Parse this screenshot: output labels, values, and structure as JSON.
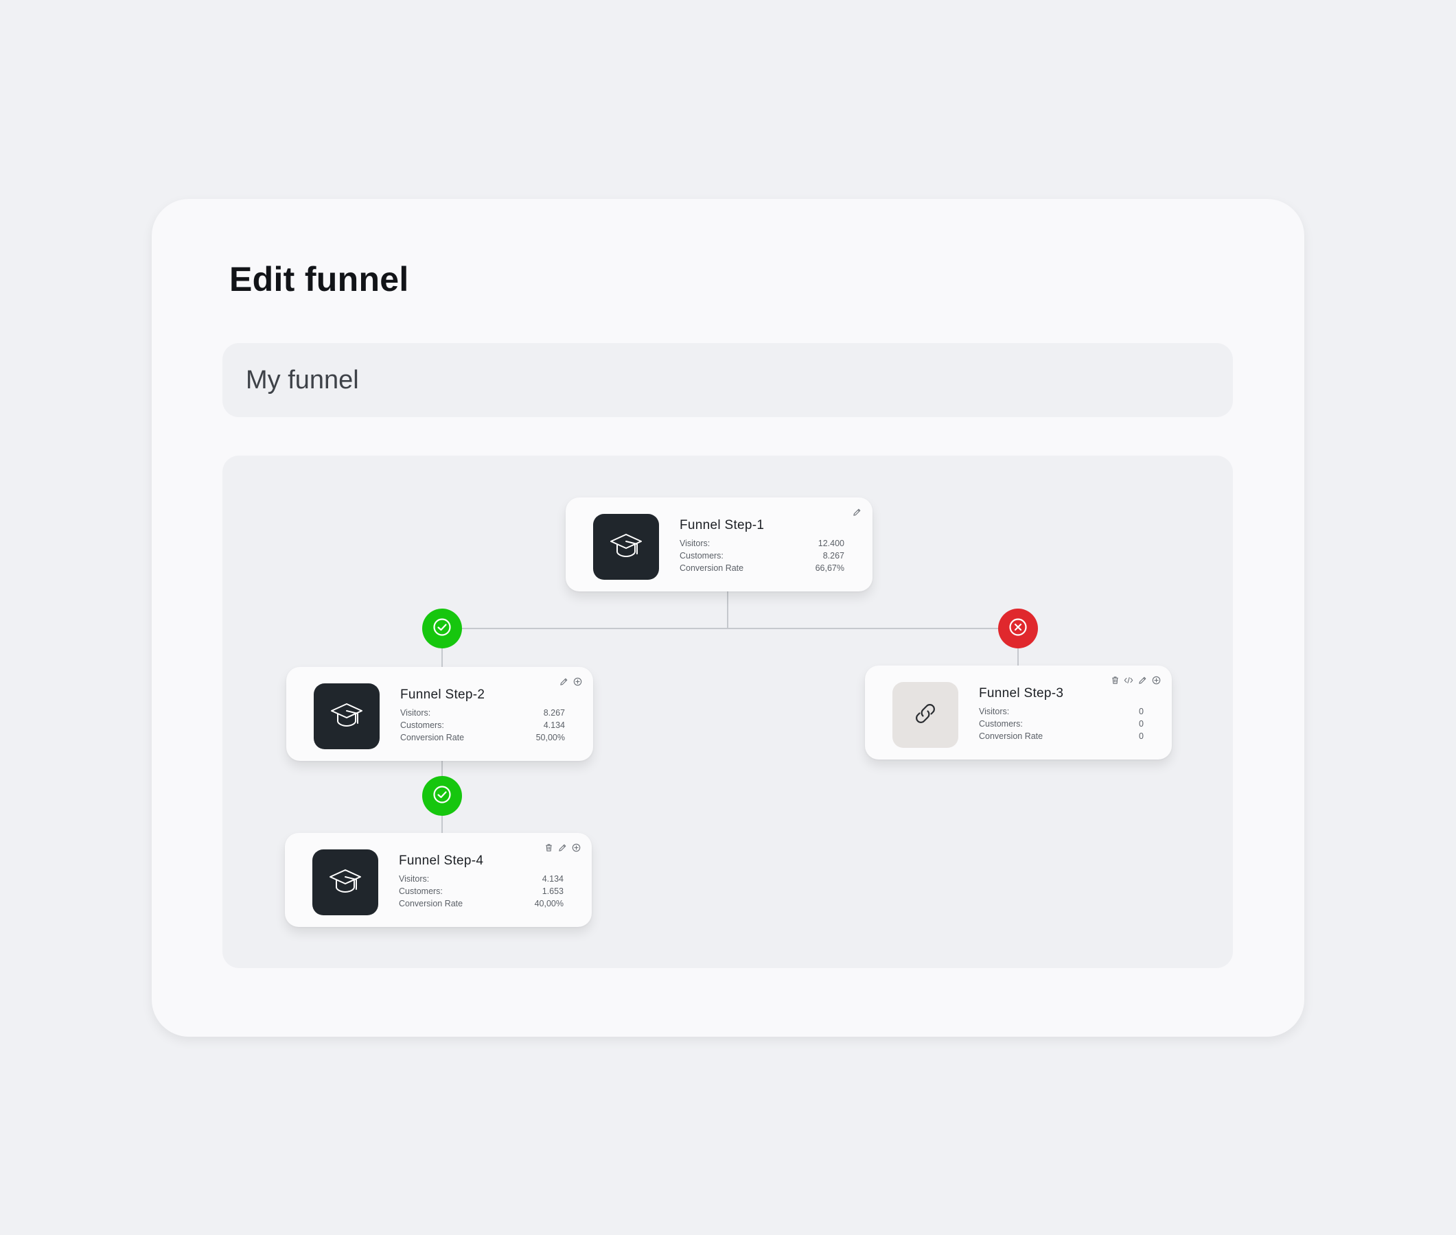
{
  "page": {
    "title": "Edit funnel"
  },
  "funnel_name": {
    "value": "My funnel"
  },
  "colors": {
    "success": "#16c60e",
    "failure": "#e0282d",
    "dark_thumb": "#20262c",
    "light_thumb": "#e6e3e1"
  },
  "labels": {
    "visitors": "Visitors:",
    "customers": "Customers:",
    "conversion_rate": "Conversion Rate"
  },
  "steps": [
    {
      "title": "Funnel Step-1",
      "icon": "graduation-cap-icon",
      "visitors": "12.400",
      "customers": "8.267",
      "conversion_rate": "66,67%",
      "actions": [
        "edit-icon"
      ]
    },
    {
      "title": "Funnel Step-2",
      "icon": "graduation-cap-icon",
      "visitors": "8.267",
      "customers": "4.134",
      "conversion_rate": "50,00%",
      "actions": [
        "edit-icon",
        "add-icon"
      ]
    },
    {
      "title": "Funnel Step-3",
      "icon": "link-icon",
      "visitors": "0",
      "customers": "0",
      "conversion_rate": "0",
      "actions": [
        "trash-icon",
        "code-icon",
        "edit-icon",
        "add-icon"
      ]
    },
    {
      "title": "Funnel Step-4",
      "icon": "graduation-cap-icon",
      "visitors": "4.134",
      "customers": "1.653",
      "conversion_rate": "40,00%",
      "actions": [
        "trash-icon",
        "edit-icon",
        "add-icon"
      ]
    }
  ],
  "branches": [
    {
      "status": "success",
      "icon": "check-icon"
    },
    {
      "status": "failure",
      "icon": "x-icon"
    },
    {
      "status": "success",
      "icon": "check-icon"
    }
  ]
}
